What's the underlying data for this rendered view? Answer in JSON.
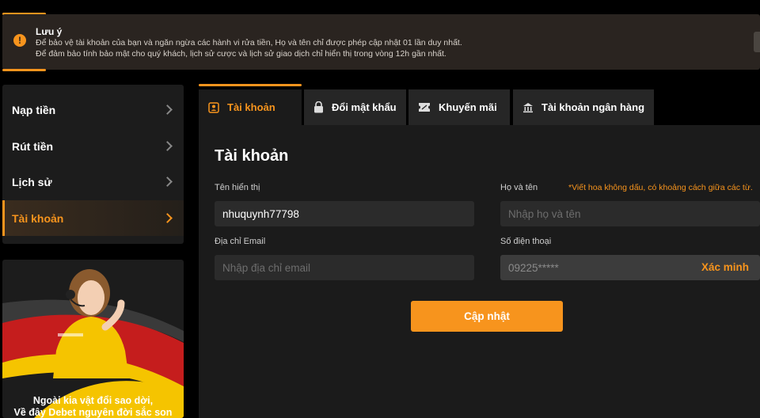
{
  "notice": {
    "title": "Lưu ý",
    "line1": "Để bảo vệ tài khoản của bạn và ngăn ngừa các hành vi rửa tiền, Họ và tên chỉ được phép cập nhật 01 lần duy nhất.",
    "line2": "Để đảm bảo tính bảo mật cho quý khách, lịch sử cược và lịch sử giao dịch chỉ hiển thị trong vòng 12h gần nhất.",
    "icon": "exclamation-icon",
    "icon_glyph": "!"
  },
  "sidebar": {
    "items": [
      {
        "label": "Nạp tiền",
        "active": false
      },
      {
        "label": "Rút tiền",
        "active": false
      },
      {
        "label": "Lịch sử",
        "active": false
      },
      {
        "label": "Tài khoản",
        "active": true
      }
    ]
  },
  "promo": {
    "line1": "Ngoài kia vật đổi sao dời,",
    "line2": "Về đây Debet nguyên đời sắc son"
  },
  "tabs": [
    {
      "label": "Tài khoản",
      "icon": "user-icon",
      "active": true
    },
    {
      "label": "Đổi mật khẩu",
      "icon": "lock-icon",
      "active": false
    },
    {
      "label": "Khuyến mãi",
      "icon": "ticket-icon",
      "active": false
    },
    {
      "label": "Tài khoản ngân hàng",
      "icon": "bank-icon",
      "active": false
    }
  ],
  "form": {
    "title": "Tài khoản",
    "display_name_label": "Tên hiển thị",
    "display_name_value": "nhuquynh77798",
    "fullname_label": "Họ và tên",
    "fullname_hint": "*Viết hoa không dấu, có khoảng cách giữa các từ.",
    "fullname_placeholder": "Nhập họ và tên",
    "email_label": "Địa chỉ Email",
    "email_placeholder": "Nhập địa chỉ email",
    "phone_label": "Số điện thoại",
    "phone_value": "09225*****",
    "verify_label": "Xác minh",
    "submit_label": "Cập nhật"
  },
  "colors": {
    "accent": "#f7941d",
    "background": "#000000",
    "panel": "#1b1b1b",
    "input": "#2b2b2b"
  }
}
